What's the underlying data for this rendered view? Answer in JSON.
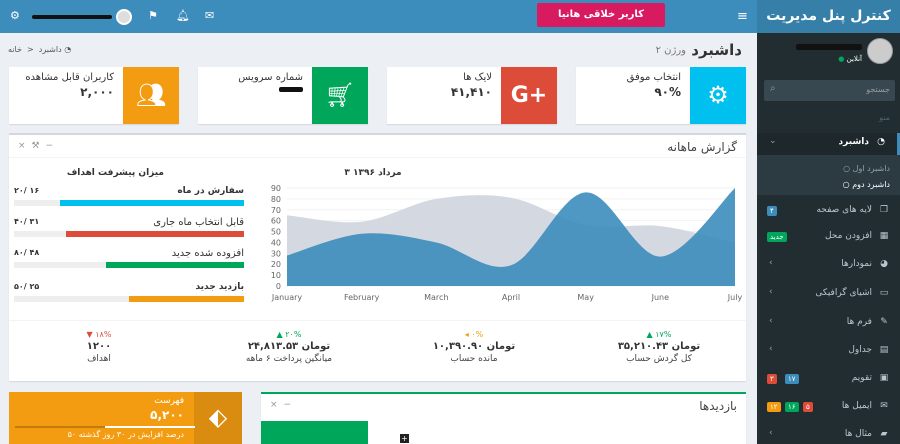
{
  "brand": "کنترل پنل مدیریت",
  "topbar": {
    "promo_label": "کاربر خلاقی هانیا",
    "menu_icon": "hamburger-icon",
    "notif_badges": {
      "mail": "",
      "bell": "",
      "flag": ""
    },
    "colors": {
      "topbar": "#3c8dbc",
      "brand": "#367fa9",
      "promo": "#d81b60"
    }
  },
  "sidebar": {
    "user_status": "آنلاین",
    "search_placeholder": "جستجو",
    "menu_header": "منو",
    "items": [
      {
        "label": "داشبرد",
        "icon": "dashboard-icon",
        "active": true,
        "children": [
          {
            "label": "داشبرد اول"
          },
          {
            "label": "داشبرد دوم"
          }
        ]
      },
      {
        "label": "لایه های صفحه",
        "icon": "files-icon",
        "badge": "۴",
        "badge_color": "#3c8dbc"
      },
      {
        "label": "افزودن محل",
        "icon": "grid-icon",
        "badge": "جدید",
        "badge_color": "#00a65a"
      },
      {
        "label": "نمودارها",
        "icon": "pie-chart-icon"
      },
      {
        "label": "اشیای گرافیکی",
        "icon": "laptop-icon"
      },
      {
        "label": "فرم ها",
        "icon": "edit-icon"
      },
      {
        "label": "جداول",
        "icon": "table-icon"
      },
      {
        "label": "تقویم",
        "icon": "calendar-icon",
        "badges": [
          {
            "t": "۱۷",
            "c": "#3c8dbc"
          },
          {
            "t": "۳",
            "c": "#dd4b39"
          }
        ]
      },
      {
        "label": "ایمیل ها",
        "icon": "envelope-icon",
        "badges": [
          {
            "t": "۵",
            "c": "#dd4b39"
          },
          {
            "t": "۱۶",
            "c": "#00a65a"
          },
          {
            "t": "۱۲",
            "c": "#f39c12"
          }
        ]
      },
      {
        "label": "مثال ها",
        "icon": "folder-icon"
      }
    ]
  },
  "page": {
    "title": "داشبرد",
    "subtitle": "ورژن ۲",
    "breadcrumb": [
      "خانه",
      "داشبرد"
    ]
  },
  "info_boxes": [
    {
      "text": "انتخاب موفق",
      "number": "۹۰%",
      "icon": "gear-icon",
      "color": "#00c0ef"
    },
    {
      "text": "لایک ها",
      "number": "۴۱,۴۱۰",
      "icon": "google-plus-icon",
      "color": "#dd4b39"
    },
    {
      "text": "شماره سرویس",
      "number": "",
      "icon": "cart-icon",
      "color": "#00a65a"
    },
    {
      "text": "کاربران قابل مشاهده",
      "number": "۲,۰۰۰",
      "icon": "users-icon",
      "color": "#f39c12"
    }
  ],
  "report": {
    "title": "گزارش ماهانه",
    "chart_caption": "۳ مرداد ۱۳۹۶",
    "goals_title": "میزان پیشرفت اهداف",
    "goals": [
      {
        "label": "سفارش در ماه",
        "value": "۲۰/ ۱۶",
        "fraction": 0.8,
        "color": "#00c0ef"
      },
      {
        "label": "قابل انتخاب ماه جاری",
        "value": "۴۰/ ۳۱",
        "fraction": 0.775,
        "color": "#dd4b39"
      },
      {
        "label": "افزوده شده جدید",
        "value": "۸۰/ ۴۸",
        "fraction": 0.6,
        "color": "#00a65a"
      },
      {
        "label": "بازدید جدید",
        "value": "۵۰/ ۲۵",
        "fraction": 0.5,
        "color": "#f39c12"
      }
    ],
    "stats": [
      {
        "pct": "▲ ۱۷%",
        "amount": "۳۵,۲۱۰.۴۳ تومان",
        "caption": "کل گردش حساب",
        "color": "#00a65a"
      },
      {
        "pct": "◂ ۰%",
        "amount": "۱۰,۳۹۰.۹۰ تومان",
        "caption": "مانده حساب",
        "color": "#f39c12"
      },
      {
        "pct": "▲ ۲۰%",
        "amount": "۲۴,۸۱۳.۵۳ تومان",
        "caption": "میانگین پرداخت ۶ ماهه",
        "color": "#00a65a"
      },
      {
        "pct": "▼ ۱۸%",
        "amount": "۱۲۰۰",
        "caption": "اهداف",
        "color": "#dd4b39"
      }
    ]
  },
  "chart_data": {
    "type": "area",
    "x": [
      "January",
      "February",
      "March",
      "April",
      "May",
      "June",
      "July"
    ],
    "ylim": [
      0,
      90
    ],
    "yticks": [
      0,
      10,
      20,
      30,
      40,
      50,
      60,
      70,
      80,
      90
    ],
    "grid": true,
    "series": [
      {
        "values": [
          65,
          59,
          80,
          81,
          56,
          55,
          40
        ],
        "color": "#d2d6de"
      },
      {
        "values": [
          28,
          48,
          40,
          19,
          86,
          27,
          90
        ],
        "color": "#3c8dbc"
      }
    ]
  },
  "sales_box": {
    "title": "فهرست",
    "number": "۵,۲۰۰",
    "progress_text": "۵۰ درصد افزایش در ۳۰ روز گذشته",
    "progress_fraction": 0.5,
    "icon": "tag-icon",
    "color": "#f39c12"
  },
  "visitors_box": {
    "title": "بازدیدها"
  }
}
